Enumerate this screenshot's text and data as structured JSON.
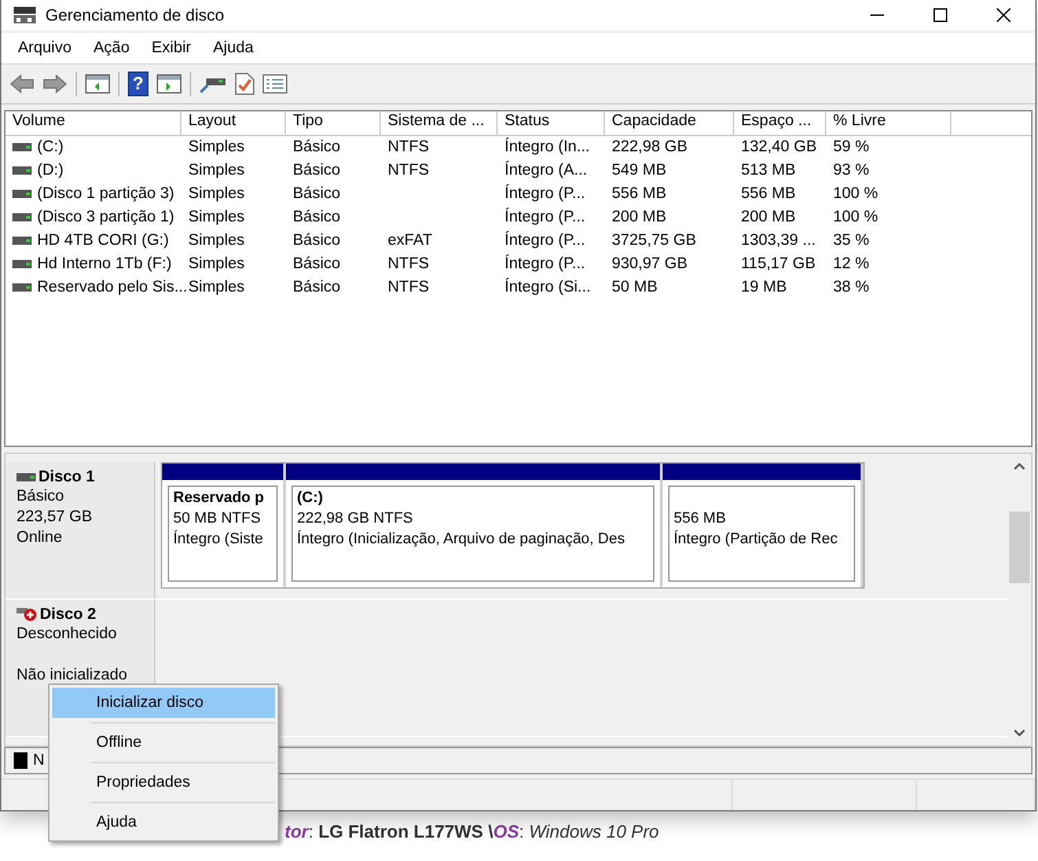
{
  "window": {
    "title": "Gerenciamento de disco"
  },
  "menu": [
    "Arquivo",
    "Ação",
    "Exibir",
    "Ajuda"
  ],
  "toolbar": {
    "help_glyph": "?"
  },
  "table": {
    "columns": [
      "Volume",
      "Layout",
      "Tipo",
      "Sistema de ...",
      "Status",
      "Capacidade",
      "Espaço ...",
      "% Livre"
    ],
    "rows": [
      [
        "(C:)",
        "Simples",
        "Básico",
        "NTFS",
        "Íntegro (In...",
        "222,98 GB",
        "132,40 GB",
        "59 %"
      ],
      [
        "(D:)",
        "Simples",
        "Básico",
        "NTFS",
        "Íntegro (A...",
        "549 MB",
        "513 MB",
        "93 %"
      ],
      [
        "(Disco 1 partição 3)",
        "Simples",
        "Básico",
        "",
        "Íntegro (P...",
        "556 MB",
        "556 MB",
        "100 %"
      ],
      [
        "(Disco 3 partição 1)",
        "Simples",
        "Básico",
        "",
        "Íntegro (P...",
        "200 MB",
        "200 MB",
        "100 %"
      ],
      [
        "HD 4TB CORI (G:)",
        "Simples",
        "Básico",
        "exFAT",
        "Íntegro (P...",
        "3725,75 GB",
        "1303,39 ...",
        "35 %"
      ],
      [
        "Hd Interno 1Tb (F:)",
        "Simples",
        "Básico",
        "NTFS",
        "Íntegro (P...",
        "930,97 GB",
        "115,17 GB",
        "12 %"
      ],
      [
        "Reservado pelo Sis...",
        "Simples",
        "Básico",
        "NTFS",
        "Íntegro (Si...",
        "50 MB",
        "19 MB",
        "38 %"
      ]
    ]
  },
  "disks": [
    {
      "kind": "online",
      "name": "Disco 1",
      "lines": [
        "Básico",
        "223,57 GB",
        "Online"
      ],
      "partitions": [
        {
          "title": "Reservado p",
          "lines": [
            "50 MB NTFS",
            "Íntegro (Siste"
          ]
        },
        {
          "title": "(C:)",
          "lines": [
            "222,98 GB NTFS",
            "Íntegro (Inicialização, Arquivo de paginação, Des"
          ]
        },
        {
          "lines": [
            "556 MB",
            "Íntegro (Partição de Rec"
          ]
        }
      ]
    },
    {
      "kind": "uninitialized",
      "name": "Disco 2",
      "lines": [
        "Desconhecido",
        "Não inicializado"
      ]
    }
  ],
  "legend": [
    {
      "label": "N",
      "color": "#000000"
    }
  ],
  "context_menu": [
    {
      "label": "Inicializar disco",
      "selected": true
    },
    {
      "label": "Offline",
      "selected": false
    },
    {
      "label": "Propriedades",
      "selected": false
    },
    {
      "label": "Ajuda",
      "selected": false
    }
  ],
  "background_text": [
    {
      "kind": "label",
      "text": "tor"
    },
    {
      "kind": "plain",
      "text": ": "
    },
    {
      "kind": "value",
      "text": "LG Flatron L177WS \\"
    },
    {
      "kind": "label",
      "text": "OS"
    },
    {
      "kind": "plain",
      "text": ": "
    },
    {
      "kind": "italic",
      "text": "Windows 10 Pro"
    }
  ]
}
